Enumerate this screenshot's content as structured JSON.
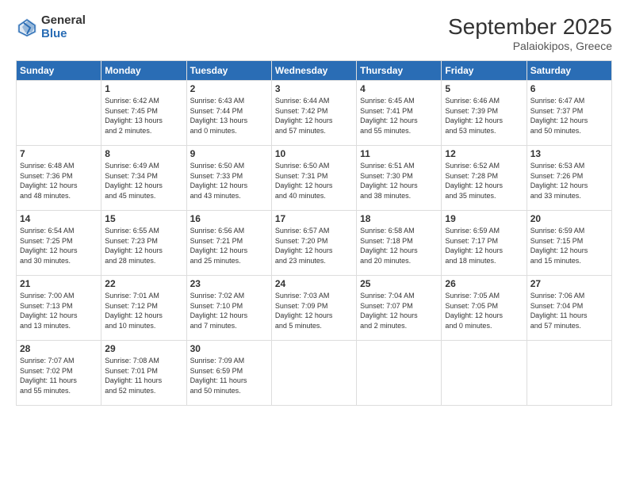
{
  "logo": {
    "general": "General",
    "blue": "Blue"
  },
  "header": {
    "month": "September 2025",
    "location": "Palaiokipos, Greece"
  },
  "weekdays": [
    "Sunday",
    "Monday",
    "Tuesday",
    "Wednesday",
    "Thursday",
    "Friday",
    "Saturday"
  ],
  "weeks": [
    [
      {
        "day": "",
        "info": ""
      },
      {
        "day": "1",
        "info": "Sunrise: 6:42 AM\nSunset: 7:45 PM\nDaylight: 13 hours\nand 2 minutes."
      },
      {
        "day": "2",
        "info": "Sunrise: 6:43 AM\nSunset: 7:44 PM\nDaylight: 13 hours\nand 0 minutes."
      },
      {
        "day": "3",
        "info": "Sunrise: 6:44 AM\nSunset: 7:42 PM\nDaylight: 12 hours\nand 57 minutes."
      },
      {
        "day": "4",
        "info": "Sunrise: 6:45 AM\nSunset: 7:41 PM\nDaylight: 12 hours\nand 55 minutes."
      },
      {
        "day": "5",
        "info": "Sunrise: 6:46 AM\nSunset: 7:39 PM\nDaylight: 12 hours\nand 53 minutes."
      },
      {
        "day": "6",
        "info": "Sunrise: 6:47 AM\nSunset: 7:37 PM\nDaylight: 12 hours\nand 50 minutes."
      }
    ],
    [
      {
        "day": "7",
        "info": "Sunrise: 6:48 AM\nSunset: 7:36 PM\nDaylight: 12 hours\nand 48 minutes."
      },
      {
        "day": "8",
        "info": "Sunrise: 6:49 AM\nSunset: 7:34 PM\nDaylight: 12 hours\nand 45 minutes."
      },
      {
        "day": "9",
        "info": "Sunrise: 6:50 AM\nSunset: 7:33 PM\nDaylight: 12 hours\nand 43 minutes."
      },
      {
        "day": "10",
        "info": "Sunrise: 6:50 AM\nSunset: 7:31 PM\nDaylight: 12 hours\nand 40 minutes."
      },
      {
        "day": "11",
        "info": "Sunrise: 6:51 AM\nSunset: 7:30 PM\nDaylight: 12 hours\nand 38 minutes."
      },
      {
        "day": "12",
        "info": "Sunrise: 6:52 AM\nSunset: 7:28 PM\nDaylight: 12 hours\nand 35 minutes."
      },
      {
        "day": "13",
        "info": "Sunrise: 6:53 AM\nSunset: 7:26 PM\nDaylight: 12 hours\nand 33 minutes."
      }
    ],
    [
      {
        "day": "14",
        "info": "Sunrise: 6:54 AM\nSunset: 7:25 PM\nDaylight: 12 hours\nand 30 minutes."
      },
      {
        "day": "15",
        "info": "Sunrise: 6:55 AM\nSunset: 7:23 PM\nDaylight: 12 hours\nand 28 minutes."
      },
      {
        "day": "16",
        "info": "Sunrise: 6:56 AM\nSunset: 7:21 PM\nDaylight: 12 hours\nand 25 minutes."
      },
      {
        "day": "17",
        "info": "Sunrise: 6:57 AM\nSunset: 7:20 PM\nDaylight: 12 hours\nand 23 minutes."
      },
      {
        "day": "18",
        "info": "Sunrise: 6:58 AM\nSunset: 7:18 PM\nDaylight: 12 hours\nand 20 minutes."
      },
      {
        "day": "19",
        "info": "Sunrise: 6:59 AM\nSunset: 7:17 PM\nDaylight: 12 hours\nand 18 minutes."
      },
      {
        "day": "20",
        "info": "Sunrise: 6:59 AM\nSunset: 7:15 PM\nDaylight: 12 hours\nand 15 minutes."
      }
    ],
    [
      {
        "day": "21",
        "info": "Sunrise: 7:00 AM\nSunset: 7:13 PM\nDaylight: 12 hours\nand 13 minutes."
      },
      {
        "day": "22",
        "info": "Sunrise: 7:01 AM\nSunset: 7:12 PM\nDaylight: 12 hours\nand 10 minutes."
      },
      {
        "day": "23",
        "info": "Sunrise: 7:02 AM\nSunset: 7:10 PM\nDaylight: 12 hours\nand 7 minutes."
      },
      {
        "day": "24",
        "info": "Sunrise: 7:03 AM\nSunset: 7:09 PM\nDaylight: 12 hours\nand 5 minutes."
      },
      {
        "day": "25",
        "info": "Sunrise: 7:04 AM\nSunset: 7:07 PM\nDaylight: 12 hours\nand 2 minutes."
      },
      {
        "day": "26",
        "info": "Sunrise: 7:05 AM\nSunset: 7:05 PM\nDaylight: 12 hours\nand 0 minutes."
      },
      {
        "day": "27",
        "info": "Sunrise: 7:06 AM\nSunset: 7:04 PM\nDaylight: 11 hours\nand 57 minutes."
      }
    ],
    [
      {
        "day": "28",
        "info": "Sunrise: 7:07 AM\nSunset: 7:02 PM\nDaylight: 11 hours\nand 55 minutes."
      },
      {
        "day": "29",
        "info": "Sunrise: 7:08 AM\nSunset: 7:01 PM\nDaylight: 11 hours\nand 52 minutes."
      },
      {
        "day": "30",
        "info": "Sunrise: 7:09 AM\nSunset: 6:59 PM\nDaylight: 11 hours\nand 50 minutes."
      },
      {
        "day": "",
        "info": ""
      },
      {
        "day": "",
        "info": ""
      },
      {
        "day": "",
        "info": ""
      },
      {
        "day": "",
        "info": ""
      }
    ]
  ]
}
